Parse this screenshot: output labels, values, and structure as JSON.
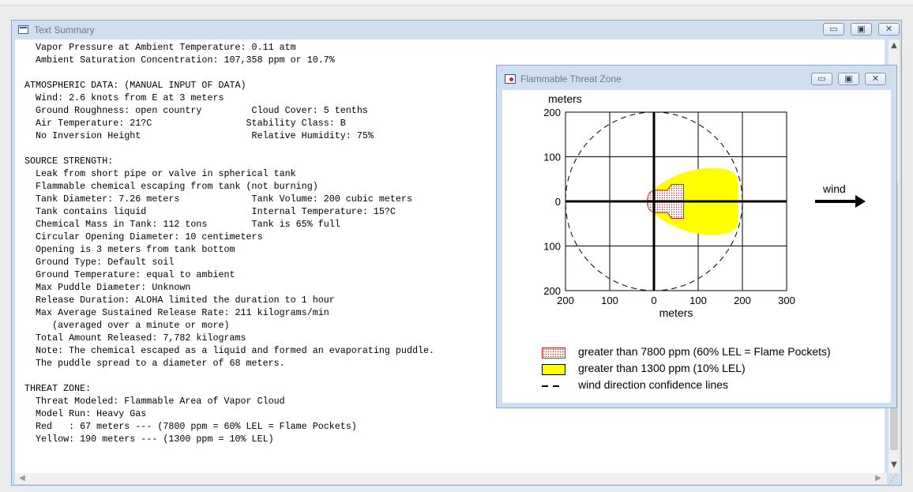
{
  "outer_window": {
    "title": "Text Summary",
    "buttons": {
      "minimize": "▭",
      "maximize": "▣",
      "close": "✕"
    }
  },
  "report": {
    "lines": [
      "  Vapor Pressure at Ambient Temperature: 0.11 atm",
      "  Ambient Saturation Concentration: 107,358 ppm or 10.7%",
      "",
      "ATMOSPHERIC DATA: (MANUAL INPUT OF DATA)",
      "  Wind: 2.6 knots from E at 3 meters",
      "  Ground Roughness: open country         Cloud Cover: 5 tenths",
      "  Air Temperature: 21?C                 Stability Class: B",
      "  No Inversion Height                    Relative Humidity: 75%",
      "",
      "SOURCE STRENGTH:",
      "  Leak from short pipe or valve in spherical tank",
      "  Flammable chemical escaping from tank (not burning)",
      "  Tank Diameter: 7.26 meters             Tank Volume: 200 cubic meters",
      "  Tank contains liquid                   Internal Temperature: 15?C",
      "  Chemical Mass in Tank: 112 tons        Tank is 65% full",
      "  Circular Opening Diameter: 10 centimeters",
      "  Opening is 3 meters from tank bottom",
      "  Ground Type: Default soil",
      "  Ground Temperature: equal to ambient",
      "  Max Puddle Diameter: Unknown",
      "  Release Duration: ALOHA limited the duration to 1 hour",
      "  Max Average Sustained Release Rate: 211 kilograms/min",
      "     (averaged over a minute or more)",
      "  Total Amount Released: 7,782 kilograms",
      "  Note: The chemical escaped as a liquid and formed an evaporating puddle.",
      "  The puddle spread to a diameter of 68 meters.",
      "",
      "THREAT ZONE:",
      "  Threat Modeled: Flammable Area of Vapor Cloud",
      "  Model Run: Heavy Gas",
      "  Red   : 67 meters --- (7800 ppm = 60% LEL = Flame Pockets)",
      "  Yellow: 190 meters --- (1300 ppm = 10% LEL)"
    ]
  },
  "inner_window": {
    "title": "Flammable Threat Zone",
    "buttons": {
      "minimize": "▭",
      "maximize": "▣",
      "close": "✕"
    }
  },
  "plot": {
    "y_unit_label": "meters",
    "x_unit_label": "meters",
    "x_tick_labels": [
      "200",
      "100",
      "0",
      "100",
      "200",
      "300"
    ],
    "y_tick_labels": [
      "200",
      "100",
      "0",
      "100",
      "200"
    ],
    "wind_label": "wind",
    "x_range": [
      -200,
      300
    ],
    "y_range": [
      -200,
      200
    ],
    "grid": true,
    "red_zone_extent_m": 67,
    "yellow_zone_extent_m": 190,
    "confidence_circle_radius_m": 200,
    "colors": {
      "red_zone": "#d21f1f",
      "yellow_zone": "#ffff00"
    }
  },
  "legend": [
    {
      "swatch": "red",
      "label": "greater than 7800 ppm (60% LEL = Flame Pockets)"
    },
    {
      "swatch": "yellow",
      "label": "greater than 1300 ppm (10% LEL)"
    },
    {
      "swatch": "dash",
      "label": "wind direction confidence lines"
    }
  ],
  "scroll": {
    "up": "▲",
    "down": "▼",
    "left": "◀",
    "right": "▶",
    "grip": "⋰"
  }
}
